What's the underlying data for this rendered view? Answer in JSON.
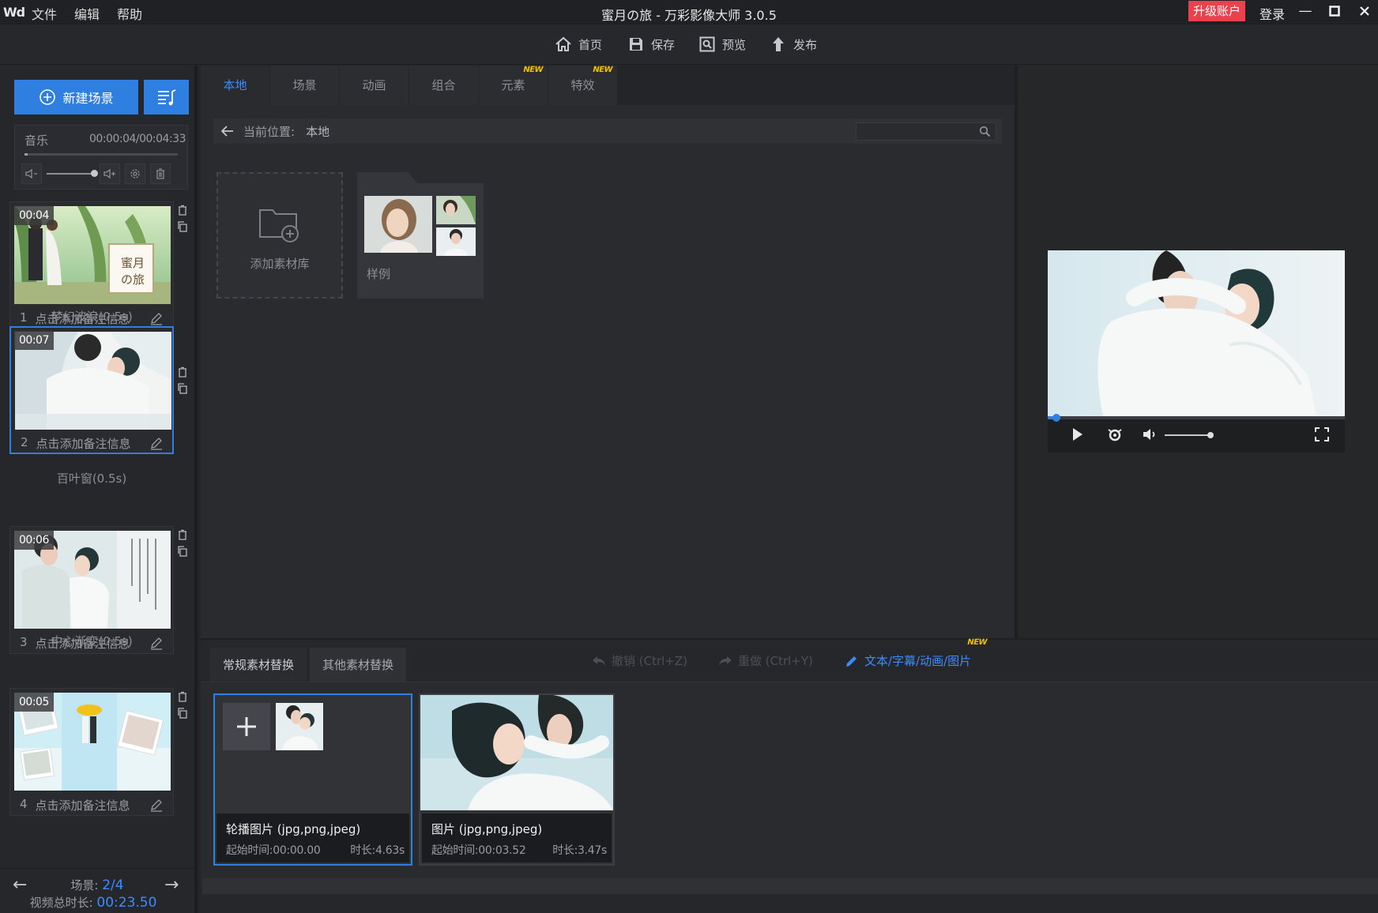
{
  "titlebar": {
    "logo": "Wd",
    "menu": [
      "文件",
      "编辑",
      "帮助"
    ],
    "title": "蜜月の旅 - 万彩影像大师 3.0.5",
    "upgrade": "升级账户",
    "login": "登录",
    "minimize": "—",
    "maximize": "▣",
    "close": "✕"
  },
  "toolbar": {
    "home": "首页",
    "save": "保存",
    "preview": "预览",
    "publish": "发布"
  },
  "left": {
    "new_scene": "新建场景",
    "music": {
      "label": "音乐",
      "time": "00:00:04/00:04:33",
      "progress": 0.015,
      "volume": 0.85
    },
    "scenes": [
      {
        "index": "1",
        "time": "00:04",
        "note": "点击添加备注信息",
        "badge_text": "蜜月\nの旅"
      },
      {
        "index": "2",
        "time": "00:07",
        "note": "点击添加备注信息"
      },
      {
        "index": "3",
        "time": "00:06",
        "note": "点击添加备注信息"
      },
      {
        "index": "4",
        "time": "00:05",
        "note": "点击添加备注信息"
      }
    ],
    "transitions": [
      "梦幻波浪(0.5s)",
      "百叶窗(0.5s)",
      "中心渐变(0.5s)"
    ],
    "footer": {
      "scene_label": "场景:",
      "scene_value": "2/4",
      "total_label": "视频总时长:",
      "total_value": "00:23.50"
    }
  },
  "library": {
    "tabs": [
      {
        "label": "本地",
        "new": false
      },
      {
        "label": "场景",
        "new": false
      },
      {
        "label": "动画",
        "new": false
      },
      {
        "label": "组合",
        "new": false
      },
      {
        "label": "元素",
        "new": true
      },
      {
        "label": "特效",
        "new": true
      }
    ],
    "new_badge": "NEW",
    "path_label": "当前位置:",
    "path_current": "本地",
    "search_placeholder": "",
    "add_library": "添加素材库",
    "folder_label": "样例"
  },
  "player": {
    "progress": 0.02,
    "volume": 0.8
  },
  "bottom": {
    "tabs": [
      "常规素材替换",
      "其他素材替换"
    ],
    "undo": "撤销 (Ctrl+Z)",
    "redo": "重做 (Ctrl+Y)",
    "text_link": "文本/字幕/动画/图片",
    "new_badge": "NEW",
    "cards": [
      {
        "title": "轮播图片 (jpg,png,jpeg)",
        "start": "起始时间:00:00.00",
        "duration": "时长:4.63s"
      },
      {
        "title": "图片 (jpg,png,jpeg)",
        "start": "起始时间:00:03.52",
        "duration": "时长:3.47s"
      }
    ]
  },
  "colors": {
    "accent": "#2f7fe0",
    "upgrade": "#e9414d",
    "new_badge": "#f3c000"
  }
}
